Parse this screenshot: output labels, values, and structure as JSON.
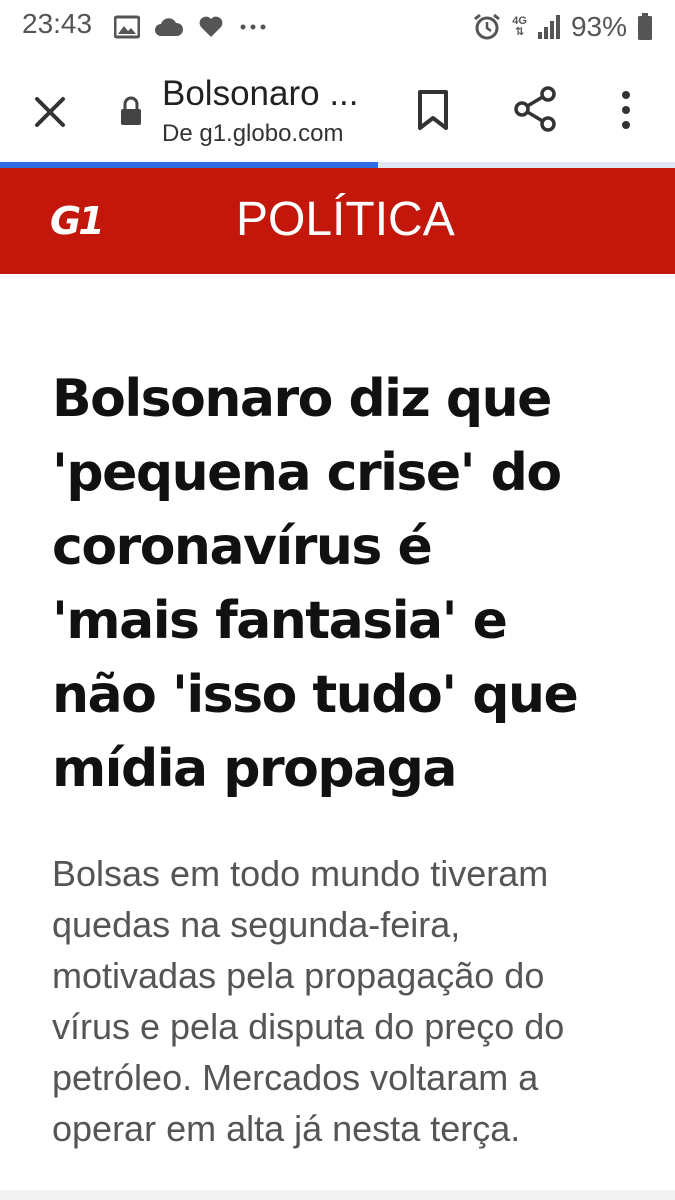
{
  "status_bar": {
    "time": "23:43",
    "battery_percent": "93%",
    "network": "4G",
    "left_icons": [
      "image-icon",
      "cloud-icon",
      "heart-icon",
      "more-notifications-icon"
    ],
    "right_icons": [
      "alarm-icon",
      "network-4g-icon",
      "signal-icon",
      "battery-icon"
    ]
  },
  "toolbar": {
    "title": "Bolsonaro ...",
    "subtitle": "De g1.globo.com",
    "icons": [
      "close-icon",
      "lock-icon",
      "bookmark-icon",
      "share-icon",
      "more-vert-icon"
    ]
  },
  "page_load_progress": 0.56,
  "colors": {
    "brand_red": "#c4170c",
    "progress_blue": "#2e6ee0",
    "headline_text": "#111111",
    "subtitle_text": "#555555"
  },
  "site_header": {
    "logo_text": "G1",
    "section": "POLÍTICA"
  },
  "article": {
    "headline_lines": [
      "Bolsonaro diz que",
      "'pequena crise' do",
      "coronavírus é",
      "'mais fantasia' e",
      "não 'isso tudo' que",
      "mídia propaga"
    ],
    "subtitle_lines": [
      "Bolsas em todo mundo tiveram",
      "quedas na segunda-feira,",
      "motivadas pela propagação do",
      "vírus e pela disputa do preço do",
      "petróleo. Mercados voltaram a",
      "operar em alta já nesta terça."
    ]
  }
}
